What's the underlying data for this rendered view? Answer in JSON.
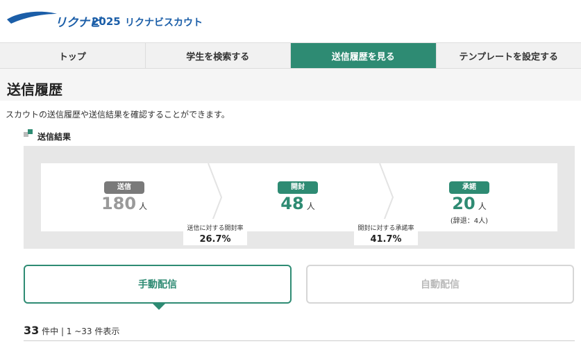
{
  "header": {
    "logo_text": "リクナビ",
    "logo_year": "2025",
    "logo_sub": "リクナビスカウト"
  },
  "nav": {
    "tabs": [
      {
        "label": "トップ"
      },
      {
        "label": "学生を検索する"
      },
      {
        "label": "送信履歴を見る"
      },
      {
        "label": "テンプレートを設定する"
      }
    ]
  },
  "page": {
    "title": "送信履歴",
    "description": "スカウトの送信履歴や送信結果を確認することができます。"
  },
  "results": {
    "section_title": "送信結果",
    "sent": {
      "badge": "送信",
      "value": "180",
      "unit": "人"
    },
    "opened": {
      "badge": "開封",
      "value": "48",
      "unit": "人"
    },
    "accepted": {
      "badge": "承諾",
      "value": "20",
      "unit": "人",
      "sub": "(辞退：4人)"
    },
    "open_rate": {
      "label": "送信に対する開封率",
      "value": "26.7%"
    },
    "accept_rate": {
      "label": "開封に対する承諾率",
      "value": "41.7%"
    }
  },
  "toggle": {
    "manual": "手動配信",
    "auto": "自動配信"
  },
  "listing": {
    "total": "33",
    "total_suffix": "件中",
    "range": "| 1 ~33 件表示"
  },
  "colors": {
    "accent": "#2e8b73",
    "brand": "#1b5ea8",
    "muted": "#9a9a9a"
  }
}
